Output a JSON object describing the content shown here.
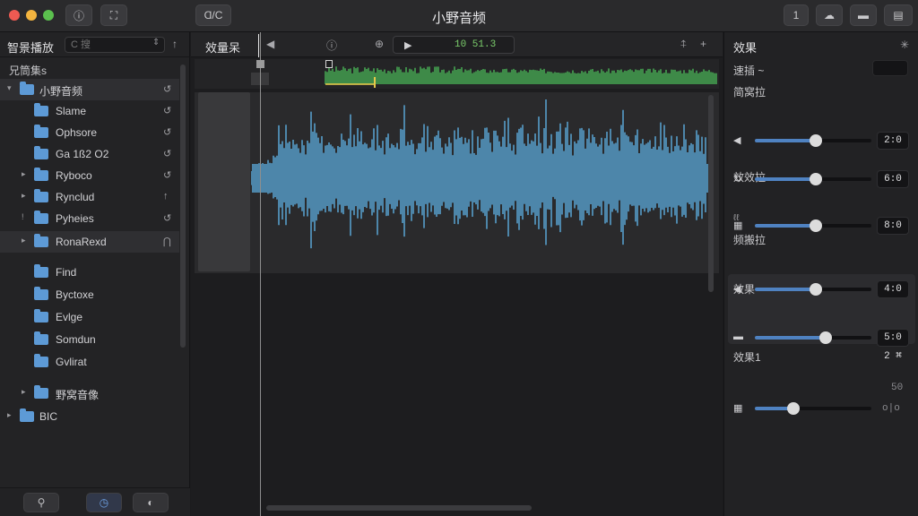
{
  "window": {
    "title": "小野音频",
    "toolbar_left_btn_label": "Ɑ/C",
    "toolbar_right_btn_label": "1"
  },
  "sidebar": {
    "title": "智景播放",
    "search_placeholder": "C 搜",
    "section_label": "兄筒集s",
    "items": [
      {
        "label": "小野音频",
        "level": 0,
        "twisty": "▾",
        "action": "↺",
        "selected": true
      },
      {
        "label": "Slame",
        "level": 1,
        "twisty": "",
        "action": "↺"
      },
      {
        "label": "Ophsore",
        "level": 1,
        "twisty": "",
        "action": "↺"
      },
      {
        "label": "Ga 1ß2 O2",
        "level": 1,
        "twisty": "",
        "action": "↺"
      },
      {
        "label": "Ryboco",
        "level": 1,
        "twisty": "▸",
        "action": "↺"
      },
      {
        "label": "Rynclud",
        "level": 1,
        "twisty": "▸",
        "action": "↑"
      },
      {
        "label": "Pyheies",
        "level": 1,
        "twisty": "!",
        "action": "↺"
      },
      {
        "label": "RonaRexd",
        "level": 1,
        "twisty": "▸",
        "action": "⋂",
        "selected": true
      },
      {
        "label": "Find",
        "level": 1,
        "twisty": "",
        "action": ""
      },
      {
        "label": "Byctoxe",
        "level": 1,
        "twisty": "",
        "action": ""
      },
      {
        "label": "Evlge",
        "level": 1,
        "twisty": "",
        "action": ""
      },
      {
        "label": "Somdun",
        "level": 1,
        "twisty": "",
        "action": ""
      },
      {
        "label": "Gvlirat",
        "level": 1,
        "twisty": "",
        "action": ""
      },
      {
        "label": "野窝音像",
        "level": 1,
        "twisty": "▸",
        "action": ""
      },
      {
        "label": "BIC",
        "level": 0,
        "twisty": "▸",
        "action": ""
      }
    ],
    "footer": {
      "search_icon": "search-icon",
      "clock_icon": "clock-icon",
      "tag_icon": "tag-icon"
    }
  },
  "editor": {
    "title": "效量呆",
    "timecode": "10 51.3",
    "play_symbol": "▶"
  },
  "effects": {
    "title": "效果",
    "subtitle": "速插 ~",
    "group1_label": "简窝拉",
    "group2_label": "效效拉",
    "group2_extra": "ℓℓ",
    "group3_label": "频搬拉",
    "group4_label": "效果",
    "group5_label": "效果1",
    "controls": [
      {
        "icon": "◀",
        "value_label": "2:0",
        "fraction": 0.52
      },
      {
        "icon": "↻",
        "value_label": "6:0",
        "fraction": 0.52
      },
      {
        "icon": "▦",
        "value_label": "8:0",
        "fraction": 0.52
      },
      {
        "icon": "◀",
        "value_label": "4:0",
        "fraction": 0.52
      },
      {
        "icon": "▬",
        "value_label": "5:0",
        "value_label2": "2 ⌘",
        "fraction": 0.61
      },
      {
        "icon": "▦",
        "value_label": "50",
        "value_label2": "o|o",
        "fraction": 0.33
      }
    ]
  },
  "colors": {
    "accent": "#4f82c1",
    "waveform": "#4d86aa",
    "overview_wave": "#3e8a48",
    "timecode": "#7ccf6c"
  }
}
